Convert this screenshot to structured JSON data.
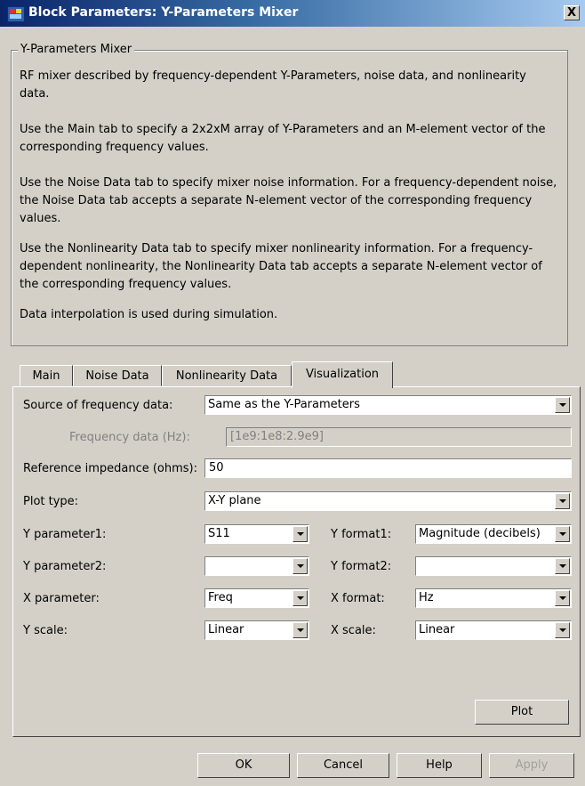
{
  "window": {
    "title": "Block Parameters: Y-Parameters Mixer",
    "close_label": "X"
  },
  "group": {
    "title": "Y-Parameters Mixer",
    "paragraphs": [
      [
        "RF mixer described by frequency-dependent Y-Parameters, noise data, and nonlinearity",
        "data."
      ],
      [
        "Use the Main tab to specify a 2x2xM array of Y-Parameters and an M-element vector of the",
        "corresponding frequency values."
      ],
      [
        "Use the Noise Data tab to specify mixer noise information. For a frequency-dependent noise,",
        "the Noise Data tab accepts a separate N-element vector of the corresponding frequency",
        "values."
      ],
      [
        "Use the Nonlinearity Data tab to specify mixer nonlinearity information. For a frequency-",
        "dependent nonlinearity, the Nonlinearity Data tab accepts a separate N-element vector of",
        "the corresponding frequency values."
      ],
      [
        "Data interpolation is used during simulation."
      ]
    ]
  },
  "tabs": [
    {
      "label": "Main",
      "active": false
    },
    {
      "label": "Noise Data",
      "active": false
    },
    {
      "label": "Nonlinearity Data",
      "active": false
    },
    {
      "label": "Visualization",
      "active": true
    }
  ],
  "form": {
    "source_label": "Source of frequency data:",
    "source_value": "Same as the Y-Parameters",
    "freq_label": "Frequency data (Hz):",
    "freq_value": "[1e9:1e8:2.9e9]",
    "ref_label": "Reference impedance (ohms):",
    "ref_value": "50",
    "plot_type_label": "Plot type:",
    "plot_type_value": "X-Y plane",
    "yparam1_label": "Y parameter1:",
    "yparam1_value": "S11",
    "yformat1_label": "Y format1:",
    "yformat1_value": "Magnitude (decibels)",
    "yparam2_label": "Y parameter2:",
    "yparam2_value": "",
    "yformat2_label": "Y format2:",
    "yformat2_value": "",
    "xparam_label": "X parameter:",
    "xparam_value": "Freq",
    "xformat_label": "X format:",
    "xformat_value": "Hz",
    "yscale_label": "Y scale:",
    "yscale_value": "Linear",
    "xscale_label": "X scale:",
    "xscale_value": "Linear",
    "plot_button": "Plot"
  },
  "buttons": {
    "ok": "OK",
    "cancel": "Cancel",
    "help": "Help",
    "apply": "Apply"
  }
}
